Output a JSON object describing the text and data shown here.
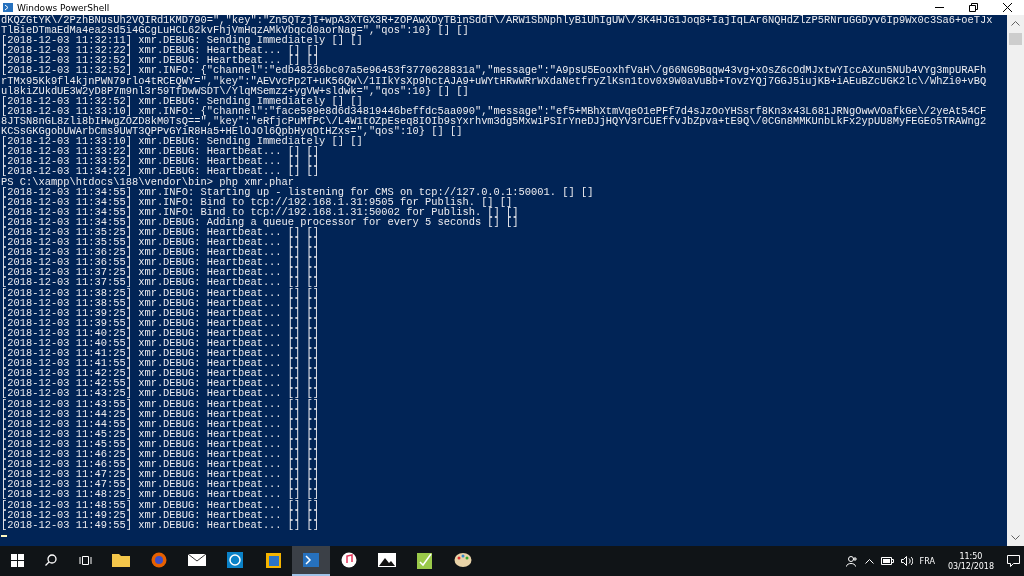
{
  "window": {
    "title": "Windows PowerShell"
  },
  "console": {
    "lines": [
      "dKQZGtYK\\/2PzhBNusUh2VQIRd1KMD790=\",\"key\":\"Zn5QTzjI+wpA3XTGX3R+zOPAwXDyTBinSddT\\/ARW1SbNphlyBiUhIgUW\\/3K4HJG1Joq8+IajIqLAr6NQHdZlzP5RNruGGDyv6Ip9Wx0c3Sa6+oeTJx",
      "TlBieDTmaEdMa4ea2sd5i4GCgLuHCL62kvFhjVmHqzAMkVbqcd0aorNag=\",\"qos\":10} [] []",
      "[2018-12-03 11:32:11] xmr.DEBUG: Sending Immediately [] []",
      "[2018-12-03 11:32:22] xmr.DEBUG: Heartbeat... [] []",
      "[2018-12-03 11:32:52] xmr.DEBUG: Heartbeat... [] []",
      "[2018-12-03 11:32:52] xmr.INFO: {\"channel\":\"edb48236bc07a5e96453f3770628831a\",\"message\":\"A9psU5EooxhfVaH\\/g66NG9Bqqw43vg+xOsZ6cOdMJxtwYIccAXun5NUb4VYg3mpURAFh",
      "rTMx95Kk9fl4kjnPWN79rlo4tRCEQWY=\",\"key\":\"AEVvcPp2T+uK56Qw\\/1IIkYsXp9hctAJA9+uWYtHRwWRrWXdaNetfryZlKsn1tov0x9W0aVuBb+TovzYQj7GGJ5iujKB+iAEuBZcUGK2lc\\/WhZi0+vBQ",
      "ul8kiZUkdUE3W2yD8P7m9nl3r59TfDwWSDT\\/YlqMSemzz+ygVW+sldwk=\",\"qos\":10} [] []",
      "[2018-12-03 11:32:52] xmr.DEBUG: Sending Immediately [] []",
      "[2018-12-03 11:33:10] xmr.INFO: {\"channel\":\"face599e8d6d34819446beffdc5aa090\",\"message\":\"ef5+MBhXtmVqeO1ePFf7d4sJzOoYHSsrf8Kn3x43L681JRNgOwwVOafkGe\\/2yeAt54CF",
      "8JTSN8nGL8zli8bIHwgZOZD8kM0TsQ==\",\"key\":\"eRfjcPuMfPC\\/L4W1tOZpEseq8IOIb9sYxrhvm3dg5MxwiPSIrYneDJjHQYV3rCUEffvJbZpva+tE9Q\\/0CGn8MMKUnbLkFx2ypUU8MyFEGEo5TRAWng2",
      "KCSsGKGgobUWArbCms9UWT3QPPvGYiR8Ha5+HElOJOl6QpbHyqOtHZxs=\",\"qos\":10} [] []",
      "[2018-12-03 11:33:10] xmr.DEBUG: Sending Immediately [] []",
      "[2018-12-03 11:33:22] xmr.DEBUG: Heartbeat... [] []",
      "[2018-12-03 11:33:52] xmr.DEBUG: Heartbeat... [] []",
      "[2018-12-03 11:34:22] xmr.DEBUG: Heartbeat... [] []",
      "PS C:\\xampp\\htdocs\\188\\vendor\\bin> php xmr.phar",
      "[2018-12-03 11:34:55] xmr.INFO: Starting up - listening for CMS on tcp://127.0.0.1:50001. [] []",
      "[2018-12-03 11:34:55] xmr.INFO: Bind to tcp://192.168.1.31:9505 for Publish. [] []",
      "[2018-12-03 11:34:55] xmr.INFO: Bind to tcp://192.168.1.31:50002 for Publish. [] []",
      "[2018-12-03 11:34:55] xmr.DEBUG: Adding a queue processor for every 5 seconds [] []",
      "[2018-12-03 11:35:25] xmr.DEBUG: Heartbeat... [] []",
      "[2018-12-03 11:35:55] xmr.DEBUG: Heartbeat... [] []",
      "[2018-12-03 11:36:25] xmr.DEBUG: Heartbeat... [] []",
      "[2018-12-03 11:36:55] xmr.DEBUG: Heartbeat... [] []",
      "[2018-12-03 11:37:25] xmr.DEBUG: Heartbeat... [] []",
      "[2018-12-03 11:37:55] xmr.DEBUG: Heartbeat... [] []",
      "[2018-12-03 11:38:25] xmr.DEBUG: Heartbeat... [] []",
      "[2018-12-03 11:38:55] xmr.DEBUG: Heartbeat... [] []",
      "[2018-12-03 11:39:25] xmr.DEBUG: Heartbeat... [] []",
      "[2018-12-03 11:39:55] xmr.DEBUG: Heartbeat... [] []",
      "[2018-12-03 11:40:25] xmr.DEBUG: Heartbeat... [] []",
      "[2018-12-03 11:40:55] xmr.DEBUG: Heartbeat... [] []",
      "[2018-12-03 11:41:25] xmr.DEBUG: Heartbeat... [] []",
      "[2018-12-03 11:41:55] xmr.DEBUG: Heartbeat... [] []",
      "[2018-12-03 11:42:25] xmr.DEBUG: Heartbeat... [] []",
      "[2018-12-03 11:42:55] xmr.DEBUG: Heartbeat... [] []",
      "[2018-12-03 11:43:25] xmr.DEBUG: Heartbeat... [] []",
      "[2018-12-03 11:43:55] xmr.DEBUG: Heartbeat... [] []",
      "[2018-12-03 11:44:25] xmr.DEBUG: Heartbeat... [] []",
      "[2018-12-03 11:44:55] xmr.DEBUG: Heartbeat... [] []",
      "[2018-12-03 11:45:25] xmr.DEBUG: Heartbeat... [] []",
      "[2018-12-03 11:45:55] xmr.DEBUG: Heartbeat... [] []",
      "[2018-12-03 11:46:25] xmr.DEBUG: Heartbeat... [] []",
      "[2018-12-03 11:46:55] xmr.DEBUG: Heartbeat... [] []",
      "[2018-12-03 11:47:25] xmr.DEBUG: Heartbeat... [] []",
      "[2018-12-03 11:47:55] xmr.DEBUG: Heartbeat... [] []",
      "[2018-12-03 11:48:25] xmr.DEBUG: Heartbeat... [] []",
      "[2018-12-03 11:48:55] xmr.DEBUG: Heartbeat... [] []",
      "[2018-12-03 11:49:25] xmr.DEBUG: Heartbeat... [] []",
      "[2018-12-03 11:49:55] xmr.DEBUG: Heartbeat... [] []"
    ]
  },
  "taskbar": {
    "apps": [
      {
        "kind": "folder",
        "selected": false
      },
      {
        "kind": "browser",
        "selected": false
      },
      {
        "kind": "mail",
        "selected": false
      },
      {
        "kind": "chat",
        "selected": false
      },
      {
        "kind": "files",
        "selected": false
      },
      {
        "kind": "terminal",
        "selected": true
      },
      {
        "kind": "music",
        "selected": false
      },
      {
        "kind": "photos",
        "selected": false
      },
      {
        "kind": "notes",
        "selected": false
      },
      {
        "kind": "paint",
        "selected": false
      }
    ],
    "language": "FRA",
    "time": "11:50",
    "date": "03/12/2018"
  }
}
